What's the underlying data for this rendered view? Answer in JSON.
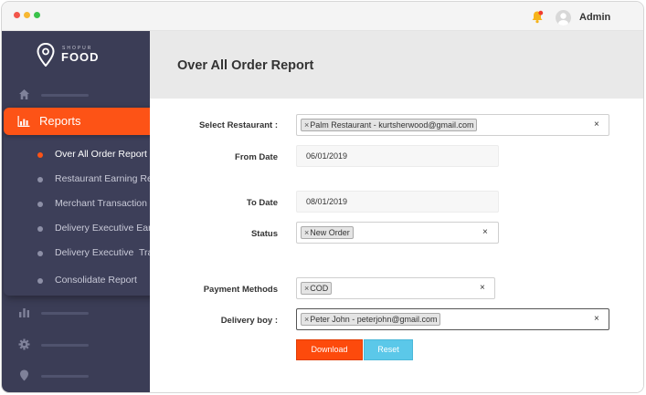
{
  "topbar": {
    "admin_name": "Admin"
  },
  "brand": {
    "small": "SHOPUR",
    "big": "FOOD",
    "accent": "#fd5316"
  },
  "sidebar": {
    "icons": [
      "home-icon",
      "bar-chart-icon",
      "gear-icon",
      "location-pin-icon"
    ],
    "reports_label": "Reports",
    "sub_items": [
      {
        "label": "Over All Order Report",
        "active": true
      },
      {
        "label": "Restaurant Earning Report",
        "active": false
      },
      {
        "label": "Merchant Transaction Report",
        "active": false
      },
      {
        "label": "Delivery Executive Earning",
        "active": false
      },
      {
        "label": "Delivery Executive  Transaction",
        "active": false
      },
      {
        "label": "Consolidate Report",
        "active": false
      }
    ]
  },
  "page": {
    "title": "Over All Order Report"
  },
  "form": {
    "restaurant_label": "Select Restaurant :",
    "restaurant_value": "Palm Restaurant - kurtsherwood@gmail.com",
    "from_date_label": "From Date",
    "from_date_value": "06/01/2019",
    "to_date_label": "To Date",
    "to_date_value": "08/01/2019",
    "status_label": "Status",
    "status_value": "New Order",
    "payment_label": "Payment Methods",
    "payment_value": "COD",
    "delivery_label": "Delivery boy :",
    "delivery_value": "Peter John - peterjohn@gmail.com",
    "tag_remove": "×",
    "clear": "×",
    "download_label": "Download",
    "reset_label": "Reset"
  }
}
